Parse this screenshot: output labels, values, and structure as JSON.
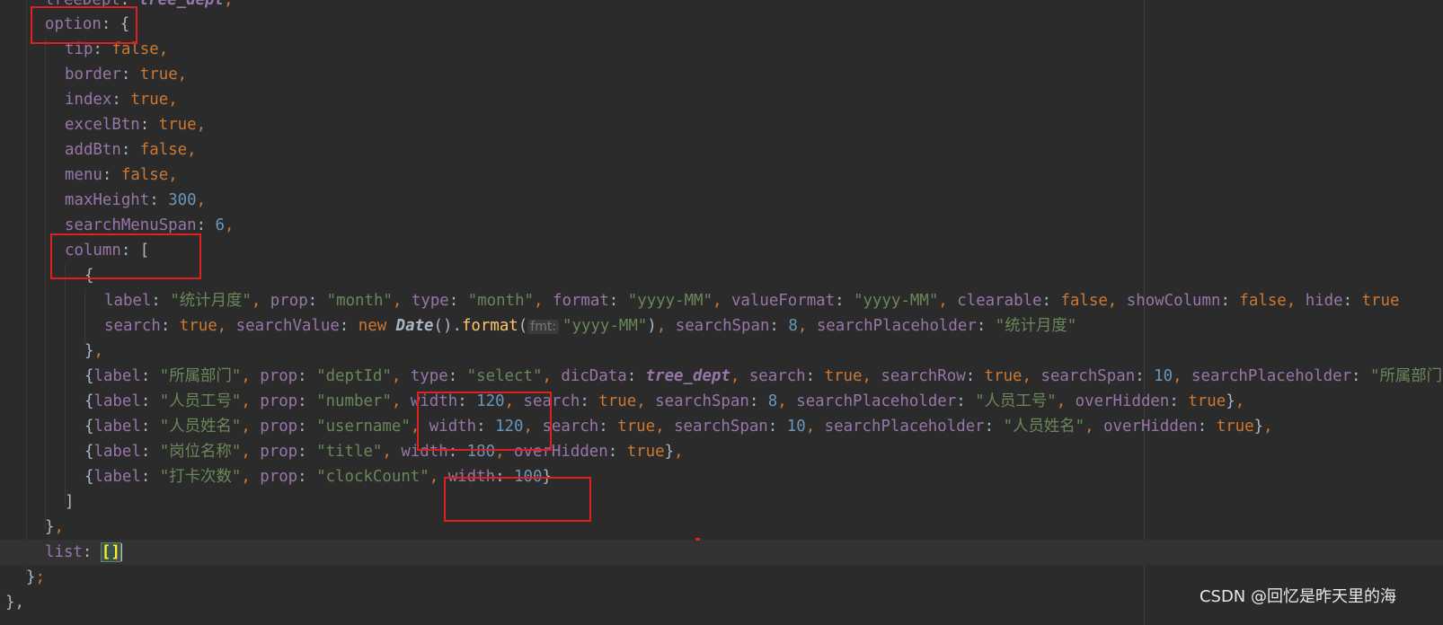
{
  "editor": {
    "lines": [
      [
        [
          "t-key",
          "treeDept"
        ],
        [
          "t-punc",
          ": "
        ],
        [
          "t-italic",
          "tree_dept"
        ],
        [
          "t-comma",
          ","
        ]
      ],
      [
        [
          "t-key",
          "option"
        ],
        [
          "t-punc",
          ": {"
        ]
      ],
      [
        [
          "t-key",
          "tip"
        ],
        [
          "t-punc",
          ": "
        ],
        [
          "t-bool",
          "false"
        ],
        [
          "t-comma",
          ","
        ]
      ],
      [
        [
          "t-key",
          "border"
        ],
        [
          "t-punc",
          ": "
        ],
        [
          "t-bool",
          "true"
        ],
        [
          "t-comma",
          ","
        ]
      ],
      [
        [
          "t-key",
          "index"
        ],
        [
          "t-punc",
          ": "
        ],
        [
          "t-bool",
          "true"
        ],
        [
          "t-comma",
          ","
        ]
      ],
      [
        [
          "t-key",
          "excelBtn"
        ],
        [
          "t-punc",
          ": "
        ],
        [
          "t-bool",
          "true"
        ],
        [
          "t-comma",
          ","
        ]
      ],
      [
        [
          "t-key",
          "addBtn"
        ],
        [
          "t-punc",
          ": "
        ],
        [
          "t-bool",
          "false"
        ],
        [
          "t-comma",
          ","
        ]
      ],
      [
        [
          "t-key",
          "menu"
        ],
        [
          "t-punc",
          ": "
        ],
        [
          "t-bool",
          "false"
        ],
        [
          "t-comma",
          ","
        ]
      ],
      [
        [
          "t-key",
          "maxHeight"
        ],
        [
          "t-punc",
          ": "
        ],
        [
          "t-num",
          "300"
        ],
        [
          "t-comma",
          ","
        ]
      ],
      [
        [
          "t-key",
          "searchMenuSpan"
        ],
        [
          "t-punc",
          ": "
        ],
        [
          "t-num",
          "6"
        ],
        [
          "t-comma",
          ","
        ]
      ],
      [
        [
          "t-key",
          "column"
        ],
        [
          "t-punc",
          ": ["
        ]
      ],
      [
        [
          "t-punc",
          "{"
        ]
      ],
      [
        [
          "t-key",
          "label"
        ],
        [
          "t-punc",
          ": "
        ],
        [
          "t-str",
          "\"统计月度\""
        ],
        [
          "t-comma",
          ", "
        ],
        [
          "t-key",
          "prop"
        ],
        [
          "t-punc",
          ": "
        ],
        [
          "t-str",
          "\"month\""
        ],
        [
          "t-comma",
          ", "
        ],
        [
          "t-key",
          "type"
        ],
        [
          "t-punc",
          ": "
        ],
        [
          "t-str",
          "\"month\""
        ],
        [
          "t-comma",
          ", "
        ],
        [
          "t-key",
          "format"
        ],
        [
          "t-punc",
          ": "
        ],
        [
          "t-str",
          "\"yyyy-MM\""
        ],
        [
          "t-comma",
          ", "
        ],
        [
          "t-key",
          "valueFormat"
        ],
        [
          "t-punc",
          ": "
        ],
        [
          "t-str",
          "\"yyyy-MM\""
        ],
        [
          "t-comma",
          ", "
        ],
        [
          "t-key",
          "clearable"
        ],
        [
          "t-punc",
          ": "
        ],
        [
          "t-bool",
          "false"
        ],
        [
          "t-comma",
          ", "
        ],
        [
          "t-key",
          "showColumn"
        ],
        [
          "t-punc",
          ": "
        ],
        [
          "t-bool",
          "false"
        ],
        [
          "t-comma",
          ", "
        ],
        [
          "t-key",
          "hide"
        ],
        [
          "t-punc",
          ": "
        ],
        [
          "t-bool",
          "true"
        ]
      ],
      [
        [
          "t-key",
          "search"
        ],
        [
          "t-punc",
          ": "
        ],
        [
          "t-bool",
          "true"
        ],
        [
          "t-comma",
          ", "
        ],
        [
          "t-key",
          "searchValue"
        ],
        [
          "t-punc",
          ": "
        ],
        [
          "t-kw",
          "new "
        ],
        [
          "t-cls",
          "Date"
        ],
        [
          "t-punc",
          "()."
        ],
        [
          "t-fn",
          "format"
        ],
        [
          "t-punc",
          "("
        ],
        [
          "t-hint",
          "fmt:"
        ],
        [
          "t-str",
          "\"yyyy-MM\""
        ],
        [
          "t-punc",
          ")"
        ],
        [
          "t-comma",
          ", "
        ],
        [
          "t-key",
          "searchSpan"
        ],
        [
          "t-punc",
          ": "
        ],
        [
          "t-num",
          "8"
        ],
        [
          "t-comma",
          ", "
        ],
        [
          "t-key",
          "searchPlaceholder"
        ],
        [
          "t-punc",
          ": "
        ],
        [
          "t-str",
          "\"统计月度\""
        ]
      ],
      [
        [
          "t-punc",
          "}"
        ],
        [
          "t-comma",
          ","
        ]
      ],
      [
        [
          "t-punc",
          "{"
        ],
        [
          "t-key",
          "label"
        ],
        [
          "t-punc",
          ": "
        ],
        [
          "t-str",
          "\"所属部门\""
        ],
        [
          "t-comma",
          ", "
        ],
        [
          "t-key",
          "prop"
        ],
        [
          "t-punc",
          ": "
        ],
        [
          "t-str",
          "\"deptId\""
        ],
        [
          "t-comma",
          ", "
        ],
        [
          "t-key",
          "type"
        ],
        [
          "t-punc",
          ": "
        ],
        [
          "t-str",
          "\"select\""
        ],
        [
          "t-comma",
          ", "
        ],
        [
          "t-key",
          "dicData"
        ],
        [
          "t-punc",
          ": "
        ],
        [
          "t-italic",
          "tree_dept"
        ],
        [
          "t-comma",
          ", "
        ],
        [
          "t-key",
          "search"
        ],
        [
          "t-punc",
          ": "
        ],
        [
          "t-bool",
          "true"
        ],
        [
          "t-comma",
          ", "
        ],
        [
          "t-key",
          "searchRow"
        ],
        [
          "t-punc",
          ": "
        ],
        [
          "t-bool",
          "true"
        ],
        [
          "t-comma",
          ", "
        ],
        [
          "t-key",
          "searchSpan"
        ],
        [
          "t-punc",
          ": "
        ],
        [
          "t-num",
          "10"
        ],
        [
          "t-comma",
          ", "
        ],
        [
          "t-key",
          "searchPlaceholder"
        ],
        [
          "t-punc",
          ": "
        ],
        [
          "t-str",
          "\"所属部门\""
        ]
      ],
      [
        [
          "t-punc",
          "{"
        ],
        [
          "t-key",
          "label"
        ],
        [
          "t-punc",
          ": "
        ],
        [
          "t-str",
          "\"人员工号\""
        ],
        [
          "t-comma",
          ", "
        ],
        [
          "t-key",
          "prop"
        ],
        [
          "t-punc",
          ": "
        ],
        [
          "t-str",
          "\"number\""
        ],
        [
          "t-comma",
          ", "
        ],
        [
          "t-key",
          "width"
        ],
        [
          "t-punc",
          ": "
        ],
        [
          "t-num",
          "120"
        ],
        [
          "t-comma",
          ", "
        ],
        [
          "t-key",
          "search"
        ],
        [
          "t-punc",
          ": "
        ],
        [
          "t-bool",
          "true"
        ],
        [
          "t-comma",
          ", "
        ],
        [
          "t-key",
          "searchSpan"
        ],
        [
          "t-punc",
          ": "
        ],
        [
          "t-num",
          "8"
        ],
        [
          "t-comma",
          ", "
        ],
        [
          "t-key",
          "searchPlaceholder"
        ],
        [
          "t-punc",
          ": "
        ],
        [
          "t-str",
          "\"人员工号\""
        ],
        [
          "t-comma",
          ", "
        ],
        [
          "t-key",
          "overHidden"
        ],
        [
          "t-punc",
          ": "
        ],
        [
          "t-bool",
          "true"
        ],
        [
          "t-punc",
          "}"
        ],
        [
          "t-comma",
          ","
        ]
      ],
      [
        [
          "t-punc",
          "{"
        ],
        [
          "t-key",
          "label"
        ],
        [
          "t-punc",
          ": "
        ],
        [
          "t-str",
          "\"人员姓名\""
        ],
        [
          "t-comma",
          ", "
        ],
        [
          "t-key",
          "prop"
        ],
        [
          "t-punc",
          ": "
        ],
        [
          "t-str",
          "\"username\""
        ],
        [
          "t-comma",
          ", "
        ],
        [
          "t-key",
          "width"
        ],
        [
          "t-punc",
          ": "
        ],
        [
          "t-num",
          "120"
        ],
        [
          "t-comma",
          ", "
        ],
        [
          "t-key",
          "search"
        ],
        [
          "t-punc",
          ": "
        ],
        [
          "t-bool",
          "true"
        ],
        [
          "t-comma",
          ", "
        ],
        [
          "t-key",
          "searchSpan"
        ],
        [
          "t-punc",
          ": "
        ],
        [
          "t-num",
          "10"
        ],
        [
          "t-comma",
          ", "
        ],
        [
          "t-key",
          "searchPlaceholder"
        ],
        [
          "t-punc",
          ": "
        ],
        [
          "t-str",
          "\"人员姓名\""
        ],
        [
          "t-comma",
          ", "
        ],
        [
          "t-key",
          "overHidden"
        ],
        [
          "t-punc",
          ": "
        ],
        [
          "t-bool",
          "true"
        ],
        [
          "t-punc",
          "}"
        ],
        [
          "t-comma",
          ","
        ]
      ],
      [
        [
          "t-punc",
          "{"
        ],
        [
          "t-key",
          "label"
        ],
        [
          "t-punc",
          ": "
        ],
        [
          "t-str",
          "\"岗位名称\""
        ],
        [
          "t-comma",
          ", "
        ],
        [
          "t-key",
          "prop"
        ],
        [
          "t-punc",
          ": "
        ],
        [
          "t-str",
          "\"title\""
        ],
        [
          "t-comma",
          ", "
        ],
        [
          "t-key",
          "width"
        ],
        [
          "t-punc",
          ": "
        ],
        [
          "t-num",
          "180"
        ],
        [
          "t-comma",
          ", "
        ],
        [
          "t-key",
          "overHidden"
        ],
        [
          "t-punc",
          ": "
        ],
        [
          "t-bool",
          "true"
        ],
        [
          "t-punc",
          "}"
        ],
        [
          "t-comma",
          ","
        ]
      ],
      [
        [
          "t-punc",
          "{"
        ],
        [
          "t-key",
          "label"
        ],
        [
          "t-punc",
          ": "
        ],
        [
          "t-str",
          "\"打卡次数\""
        ],
        [
          "t-comma",
          ", "
        ],
        [
          "t-key",
          "prop"
        ],
        [
          "t-punc",
          ": "
        ],
        [
          "t-str",
          "\"clockCount\""
        ],
        [
          "t-comma",
          ", "
        ],
        [
          "t-key",
          "width"
        ],
        [
          "t-punc",
          ": "
        ],
        [
          "t-num",
          "100"
        ],
        [
          "t-punc",
          "}"
        ]
      ],
      [
        [
          "t-punc",
          "]"
        ]
      ],
      [
        [
          "t-punc",
          "}"
        ],
        [
          "t-comma",
          ","
        ]
      ],
      [
        [
          "t-key",
          "list"
        ],
        [
          "t-punc",
          ": "
        ],
        [
          "t-match",
          "[]"
        ],
        [
          "caret",
          ""
        ]
      ],
      [
        [
          "t-punc",
          "}"
        ],
        [
          "t-comma",
          ";"
        ]
      ],
      [
        [
          "t-punc",
          "},"
        ]
      ]
    ]
  },
  "watermark": "CSDN @回忆是昨天里的海"
}
